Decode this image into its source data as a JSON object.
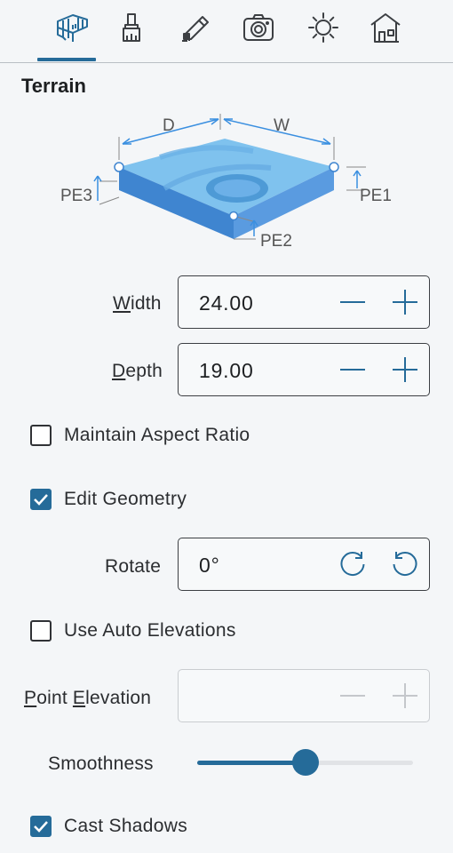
{
  "toolbar": {
    "tabs": [
      {
        "icon": "terrain-measure-icon",
        "active": true
      },
      {
        "icon": "paint-brush-icon",
        "active": false
      },
      {
        "icon": "pencil-edit-icon",
        "active": false
      },
      {
        "icon": "camera-icon",
        "active": false
      },
      {
        "icon": "sun-icon",
        "active": false
      },
      {
        "icon": "house-icon",
        "active": false
      }
    ],
    "accent_color": "#256b99"
  },
  "section_title": "Terrain",
  "diagram": {
    "label_d": "D",
    "label_w": "W",
    "label_pe1": "PE1",
    "label_pe2": "PE2",
    "label_pe3": "PE3"
  },
  "width_field": {
    "label_prefix": "W",
    "label_rest": "idth",
    "value": "24.00"
  },
  "depth_field": {
    "label_prefix": "D",
    "label_rest": "epth",
    "value": "19.00"
  },
  "maintain_aspect": {
    "label": "Maintain Aspect Ratio",
    "checked": false
  },
  "edit_geometry": {
    "label": "Edit Geometry",
    "checked": true
  },
  "rotate_field": {
    "label": "Rotate",
    "value": "0°"
  },
  "auto_elevations": {
    "label": "Use Auto Elevations",
    "checked": false
  },
  "point_elevation": {
    "label_p": "P",
    "label_mid": "oint ",
    "label_e": "E",
    "label_rest": "levation",
    "value": ""
  },
  "smoothness": {
    "label": "Smoothness",
    "value_fraction": 0.5
  },
  "cast_shadows": {
    "label": "Cast Shadows",
    "checked": true
  }
}
